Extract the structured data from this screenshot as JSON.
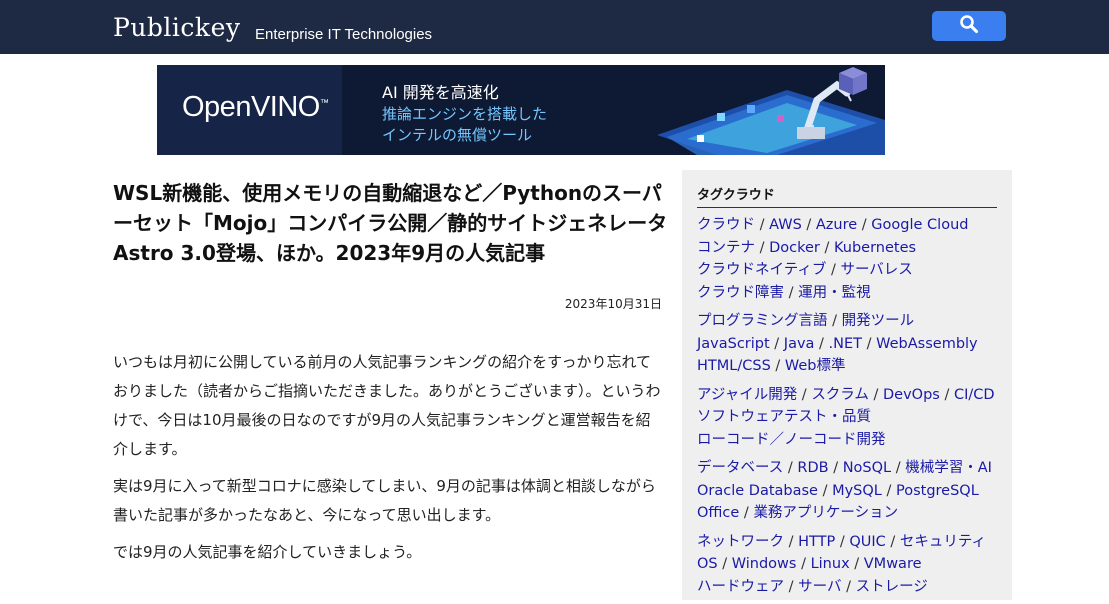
{
  "header": {
    "logo": "Publickey",
    "tagline": "Enterprise IT Technologies",
    "search_icon": "search-icon"
  },
  "banner": {
    "brand": "OpenVINO",
    "trademark": "™",
    "line1": "AI 開発を高速化",
    "line2": "推論エンジンを搭載した",
    "line3": "インテルの無償ツール"
  },
  "article": {
    "title": "WSL新機能、使用メモリの自動縮退など／Pythonのスーパーセット「Mojo」コンパイラ公開／静的サイトジェネレータAstro 3.0登場、ほか。2023年9月の人気記事",
    "date": "2023年10月31日",
    "paragraphs": [
      "いつもは月初に公開している前月の人気記事ランキングの紹介をすっかり忘れておりました（読者からご指摘いただきました。ありがとうございます）。というわけで、今日は10月最後の日なのですが9月の人気記事ランキングと運営報告を紹介します。",
      "実は9月に入って新型コロナに感染してしまい、9月の記事は体調と相談しながら書いた記事が多かったなあと、今になって思い出します。",
      "では9月の人気記事を紹介していきましょう。"
    ]
  },
  "sidebar": {
    "heading": "タグクラウド",
    "groups": [
      [
        [
          "クラウド",
          "AWS",
          "Azure",
          "Google Cloud"
        ],
        [
          "コンテナ",
          "Docker",
          "Kubernetes"
        ],
        [
          "クラウドネイティブ",
          "サーバレス"
        ],
        [
          "クラウド障害",
          "運用・監視"
        ]
      ],
      [
        [
          "プログラミング言語",
          "開発ツール"
        ],
        [
          "JavaScript",
          "Java",
          ".NET",
          "WebAssembly"
        ],
        [
          "HTML/CSS",
          "Web標準"
        ]
      ],
      [
        [
          "アジャイル開発",
          "スクラム",
          "DevOps",
          "CI/CD"
        ],
        [
          "ソフトウェアテスト・品質"
        ],
        [
          "ローコード／ノーコード開発"
        ]
      ],
      [
        [
          "データベース",
          "RDB",
          "NoSQL",
          "機械学習・AI"
        ],
        [
          "Oracle Database",
          "MySQL",
          "PostgreSQL"
        ],
        [
          "Office",
          "業務アプリケーション"
        ]
      ],
      [
        [
          "ネットワーク",
          "HTTP",
          "QUIC",
          "セキュリティ"
        ],
        [
          "OS",
          "Windows",
          "Linux",
          "VMware"
        ],
        [
          "ハードウェア",
          "サーバ",
          "ストレージ"
        ]
      ]
    ]
  }
}
